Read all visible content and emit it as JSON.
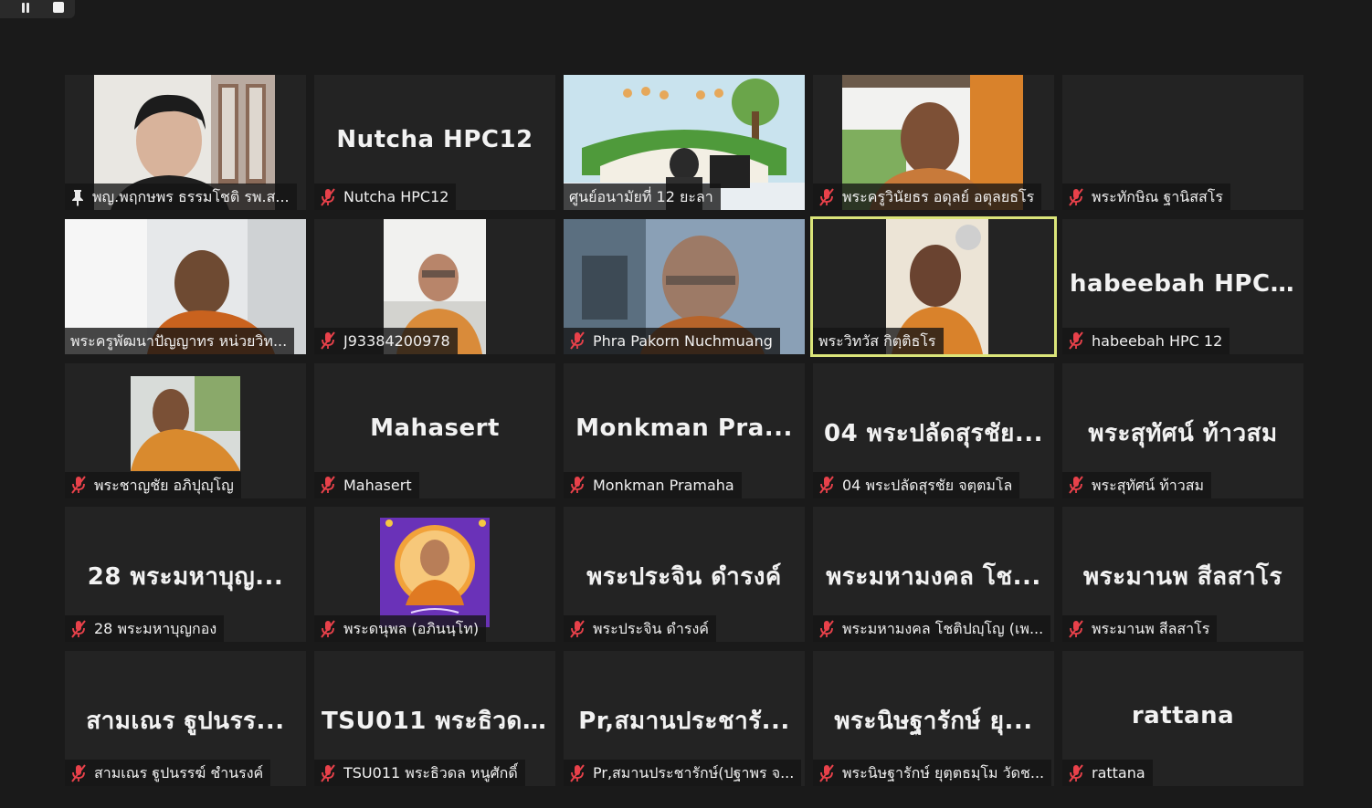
{
  "controls": {
    "pause_icon": "pause-icon",
    "stop_icon": "stop-icon"
  },
  "icons": {
    "muted": "muted-mic-icon",
    "pin": "pin-icon"
  },
  "colors": {
    "background": "#1a1a1a",
    "tile": "#232323",
    "active_speaker_border": "#dbe57a",
    "muted_icon": "#e8414a"
  },
  "participants": [
    {
      "display": "",
      "label": "พญ.พฤกษพร ธรรมโชติ รพ.ส...",
      "video": true,
      "pinned": true,
      "muted": false
    },
    {
      "display": "Nutcha HPC12",
      "label": "Nutcha HPC12",
      "video": false,
      "muted": true
    },
    {
      "display": "",
      "label": "ศูนย์อนามัยที่ 12 ยะลา",
      "video": true,
      "muted": false
    },
    {
      "display": "",
      "label": "พระครูวินัยธร อดุลย์  อตุลยธโร",
      "video": true,
      "muted": true
    },
    {
      "display": "",
      "label": "พระทักษิณ ฐานิสสโร",
      "video": false,
      "muted": true
    },
    {
      "display": "",
      "label": "พระครูพัฒนาปัญญาทร หน่วยวิท...",
      "video": true,
      "muted": false
    },
    {
      "display": "",
      "label": "J93384200978",
      "video": true,
      "muted": true
    },
    {
      "display": "",
      "label": "Phra Pakorn Nuchmuang",
      "video": true,
      "muted": true
    },
    {
      "display": "",
      "label": "พระวิทวัส กิตฺติธโร",
      "video": true,
      "muted": false,
      "active": true
    },
    {
      "display": "habeebah HPC 12",
      "label": "habeebah HPC 12",
      "video": false,
      "muted": true
    },
    {
      "display": "",
      "label": "พระชาญชัย อภิปุญฺโญ",
      "video": true,
      "muted": true
    },
    {
      "display": "Mahasert",
      "label": "Mahasert",
      "video": false,
      "muted": true
    },
    {
      "display": "Monkman  Pra...",
      "label": "Monkman Pramaha",
      "video": false,
      "muted": true
    },
    {
      "display": "04 พระปลัดสุรชัย...",
      "label": "04 พระปลัดสุรชัย จตฺตมโล",
      "video": false,
      "muted": true
    },
    {
      "display": "พระสุทัศน์  ท้าวสม",
      "label": "พระสุทัศน์  ท้าวสม",
      "video": false,
      "muted": true
    },
    {
      "display": "28   พระมหาบุญ...",
      "label": "28   พระมหาบุญกอง",
      "video": false,
      "muted": true
    },
    {
      "display": "",
      "label": "พระดนุพล (อภินนฺโท)",
      "video": true,
      "muted": true
    },
    {
      "display": "พระประจิน ดำรงค์",
      "label": "พระประจิน ดำรงค์",
      "video": false,
      "muted": true
    },
    {
      "display": "พระมหามงคล โช...",
      "label": "พระมหามงคล โชติปญฺโญ (เพ...",
      "video": false,
      "muted": true
    },
    {
      "display": "พระมานพ สีลสาโร",
      "label": "พระมานพ สีลสาโร",
      "video": false,
      "muted": true
    },
    {
      "display": "สามเณร ฐูปนรร...",
      "label": "สามเณร ฐูปนรรฆ์ ชำนรงค์",
      "video": false,
      "muted": true
    },
    {
      "display": "TSU011 พระธิวด...",
      "label": "TSU011 พระธิวดล หนูศักดิ์",
      "video": false,
      "muted": true
    },
    {
      "display": "Pr,สมานประชารั...",
      "label": "Pr,สมานประชารักษ์(ปฐาพร  จ...",
      "video": false,
      "muted": true
    },
    {
      "display": "พระนิษฐารักษ์  ยุ...",
      "label": "พระนิษฐารักษ์  ยุตฺตธมฺโม วัดช...",
      "video": false,
      "muted": true
    },
    {
      "display": "rattana",
      "label": "rattana",
      "video": false,
      "muted": true
    }
  ]
}
